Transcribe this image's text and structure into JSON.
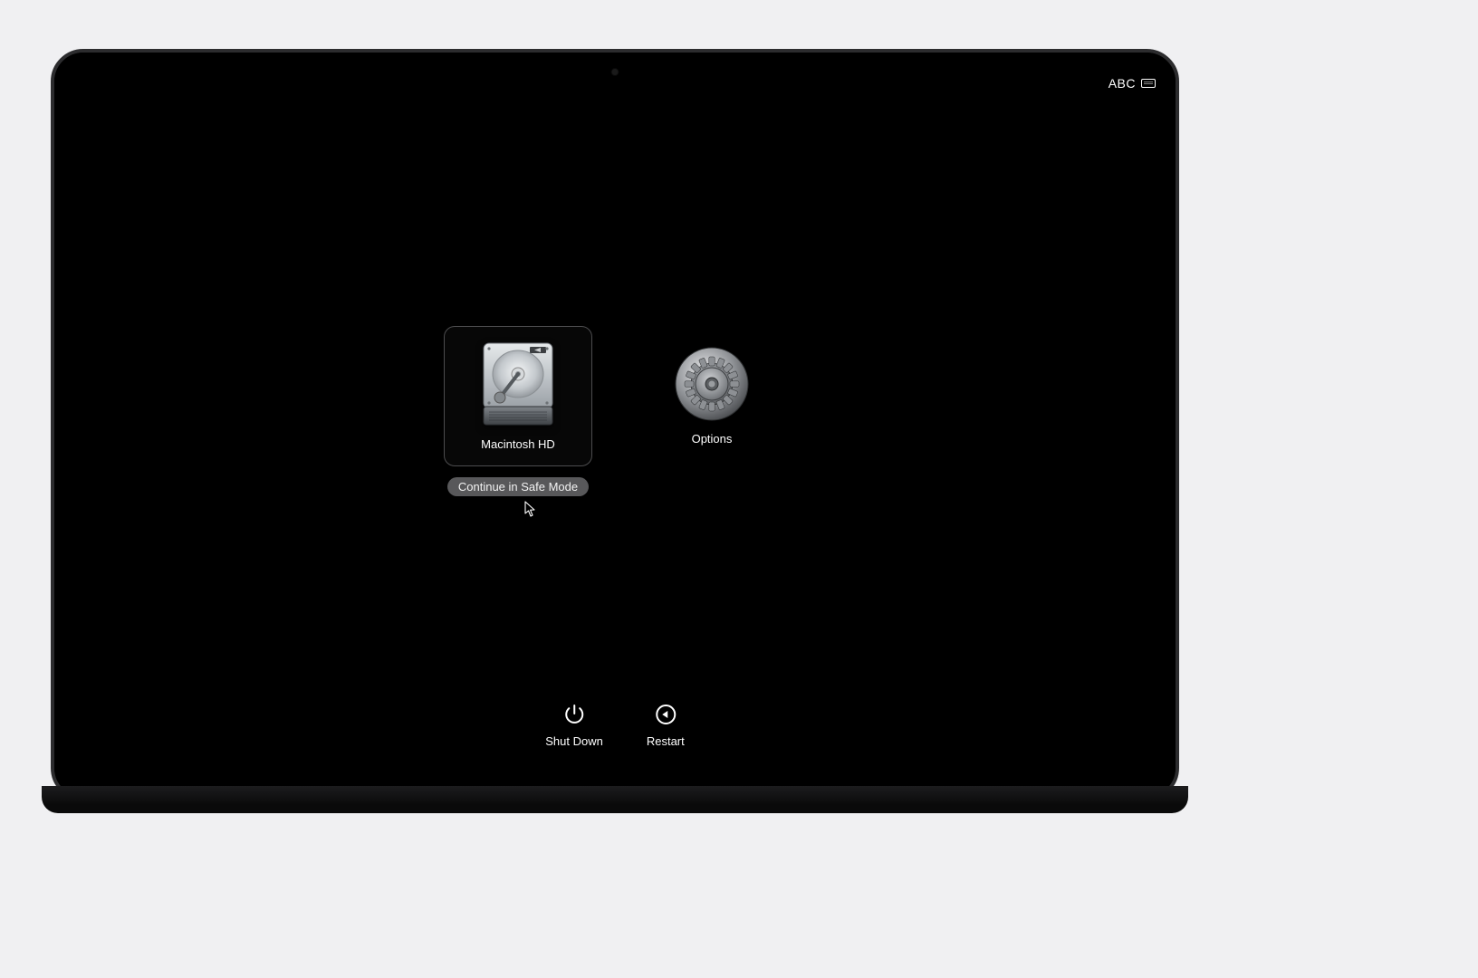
{
  "statusbar": {
    "input_label": "ABC"
  },
  "boot": {
    "disk_label": "Macintosh HD",
    "options_label": "Options",
    "safe_mode_button": "Continue in Safe Mode"
  },
  "actions": {
    "shutdown_label": "Shut Down",
    "restart_label": "Restart"
  },
  "icons": {
    "keyboard": "keyboard-icon",
    "harddrive": "harddrive-icon",
    "gear": "gear-icon",
    "power": "power-icon",
    "restart": "restart-icon"
  }
}
